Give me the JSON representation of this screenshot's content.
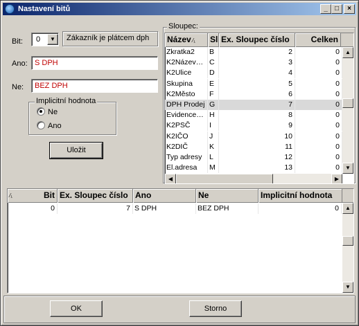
{
  "window": {
    "title": "Nastavení bitů"
  },
  "form": {
    "bit_label": "Bit:",
    "bit_value": "0",
    "bit_description": "Zákazník je plátcem dph",
    "ano_label": "Ano:",
    "ano_value": "S DPH",
    "ne_label": "Ne:",
    "ne_value": "BEZ DPH",
    "default_group_title": "Implicitní hodnota",
    "default_options": [
      {
        "label": "Ne",
        "selected": true
      },
      {
        "label": "Ano",
        "selected": false
      }
    ],
    "save_label": "Uložit"
  },
  "column_table": {
    "group_title": "Sloupec:",
    "headers": [
      "Název",
      "Sl",
      "Ex. Sloupec číslo",
      "Celken"
    ],
    "rows": [
      {
        "name": "Zkratka2",
        "col": "B",
        "num": "2",
        "total": "0"
      },
      {
        "name": "K2Název…",
        "col": "C",
        "num": "3",
        "total": "0"
      },
      {
        "name": "K2Ulice",
        "col": "D",
        "num": "4",
        "total": "0"
      },
      {
        "name": "Skupina",
        "col": "E",
        "num": "5",
        "total": "0"
      },
      {
        "name": "K2Město",
        "col": "F",
        "num": "6",
        "total": "0"
      },
      {
        "name": "DPH Prodej",
        "col": "G",
        "num": "7",
        "total": "0",
        "selected": true
      },
      {
        "name": "Evidence…",
        "col": "H",
        "num": "8",
        "total": "0"
      },
      {
        "name": "K2PSČ",
        "col": "I",
        "num": "9",
        "total": "0"
      },
      {
        "name": "K2IČO",
        "col": "J",
        "num": "10",
        "total": "0"
      },
      {
        "name": "K2DIČ",
        "col": "K",
        "num": "11",
        "total": "0"
      },
      {
        "name": "Typ adresy",
        "col": "L",
        "num": "12",
        "total": "0"
      },
      {
        "name": "El.adresa",
        "col": "M",
        "num": "13",
        "total": "0"
      }
    ]
  },
  "bits_table": {
    "headers": [
      "Bit",
      "Ex. Sloupec číslo",
      "Ano",
      "Ne",
      "Implicitní hodnota"
    ],
    "rows": [
      {
        "bit": "0",
        "col_num": "7",
        "ano": "S DPH",
        "ne": "BEZ DPH",
        "default": "0"
      }
    ]
  },
  "footer": {
    "ok_label": "OK",
    "cancel_label": "Storno"
  },
  "icons": {
    "app": "app-globe-icon",
    "minimize": "minimize-icon",
    "maximize": "maximize-icon",
    "close": "close-icon",
    "sort": "sort-ascending-icon"
  }
}
